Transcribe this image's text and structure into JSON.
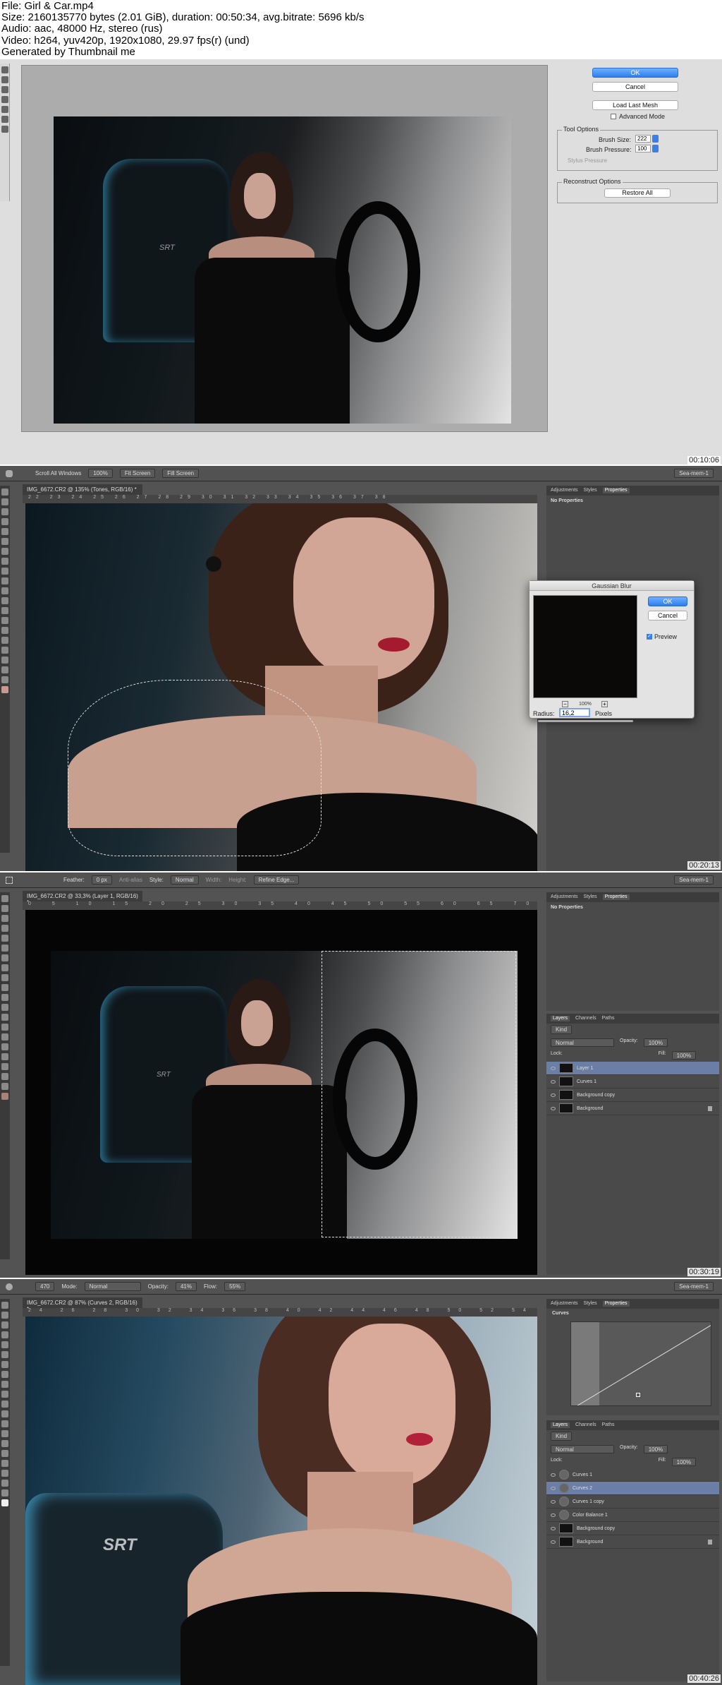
{
  "header": {
    "lines": [
      "File: Girl & Car.mp4",
      "Size: 2160135770 bytes (2.01 GiB), duration: 00:50:34, avg.bitrate: 5696 kb/s",
      "Audio: aac, 48000 Hz, stereo (rus)",
      "Video: h264, yuv420p, 1920x1080, 29.97 fps(r) (und)",
      "Generated by Thumbnail me"
    ]
  },
  "frame1": {
    "timestamp": "00:10:06",
    "buttons": {
      "ok": "OK",
      "cancel": "Cancel",
      "load_mesh": "Load Last Mesh"
    },
    "advanced_mode": "Advanced Mode",
    "tool_options": {
      "title": "Tool Options",
      "brush_size_label": "Brush Size:",
      "brush_size_value": "222",
      "brush_pressure_label": "Brush Pressure:",
      "brush_pressure_value": "100",
      "stylus": "Stylus Pressure"
    },
    "reconstruct": {
      "title": "Reconstruct Options",
      "restore_all": "Restore All"
    }
  },
  "frame2": {
    "timestamp": "00:20:13",
    "optbar": {
      "scroll_all": "Scroll All Windows",
      "zoom": "100%",
      "fit": "Fit Screen",
      "fill": "Fill Screen",
      "workspace": "Sea-mem-1"
    },
    "doc_tab": "IMG_6672.CR2 @ 135% (Tones, RGB/16) *",
    "ruler": "22 23 24 25 26 27 28 29 30 31 32 33 34 35 36 37 38",
    "panel_tabs": [
      "Adjustments",
      "Styles",
      "Properties"
    ],
    "no_properties": "No Properties",
    "dialog": {
      "title": "Gaussian Blur",
      "ok": "OK",
      "cancel": "Cancel",
      "preview": "Preview",
      "zoom": "100%",
      "radius_label": "Radius:",
      "radius_value": "16,2",
      "pixels": "Pixels"
    }
  },
  "frame3": {
    "timestamp": "00:30:19",
    "optbar": {
      "feather_label": "Feather:",
      "feather_value": "0 px",
      "anti_alias": "Anti-alias",
      "style_label": "Style:",
      "style_value": "Normal",
      "width": "Width:",
      "height": "Height:",
      "refine": "Refine Edge...",
      "workspace": "Sea-mem-1"
    },
    "doc_tab": "IMG_6672.CR2 @ 33,3% (Layer 1, RGB/16) *",
    "ruler": "0 5 10 15 20 25 30 35 40 45 50 55 60 65 70 75 80 85 90 95 100",
    "panel_tabs": [
      "Adjustments",
      "Styles",
      "Properties"
    ],
    "no_properties": "No Properties",
    "layer_tabs": [
      "Layers",
      "Channels",
      "Paths"
    ],
    "kind": "Kind",
    "blend": "Normal",
    "opacity_label": "Opacity:",
    "opacity_value": "100%",
    "lock_label": "Lock:",
    "fill_label": "Fill:",
    "fill_value": "100%",
    "layers": [
      "Layer 1",
      "Curves 1",
      "Background copy",
      "Background"
    ]
  },
  "frame4": {
    "timestamp": "00:40:26",
    "optbar": {
      "brush_size": "470",
      "mode_label": "Mode:",
      "mode_value": "Normal",
      "opacity_label": "Opacity:",
      "opacity_value": "41%",
      "flow_label": "Flow:",
      "flow_value": "55%",
      "workspace": "Sea-mem-1"
    },
    "doc_tab": "IMG_6672.CR2 @ 87% (Curves 2, RGB/16) *",
    "ruler": "24 26 28 30 32 34 36 38 40 42 44 46 48 50 52 54 56 58 60 62",
    "panel_tabs": [
      "Adjustments",
      "Styles",
      "Properties"
    ],
    "curves_label": "Curves",
    "layer_tabs": [
      "Layers",
      "Channels",
      "Paths"
    ],
    "kind": "Kind",
    "blend": "Normal",
    "opacity_label": "Opacity:",
    "opacity_value": "100%",
    "lock_label": "Lock:",
    "fill_label": "Fill:",
    "fill_value": "100%",
    "layers": [
      "Curves 1",
      "Curves 2",
      "Curves 1 copy",
      "Color Balance 1",
      "Background copy",
      "Background"
    ],
    "brand": "SRT"
  }
}
